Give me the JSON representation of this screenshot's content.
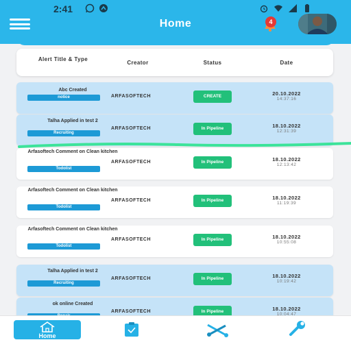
{
  "status_bar": {
    "time": "2:41"
  },
  "header": {
    "title": "Home",
    "notification_count": "4"
  },
  "table": {
    "columns": [
      "Alert Title & Type",
      "Creator",
      "Status",
      "Date"
    ]
  },
  "rows": [
    {
      "title": "Abc Created",
      "type": "notice",
      "creator": "ARFASOFTECH",
      "status": "CREATE",
      "date": "20.10.2022",
      "time": "14:37:16",
      "style": "blue"
    },
    {
      "title": "Talha Applied in test 2",
      "type": "Recruiting",
      "creator": "ARFASOFTECH",
      "status": "In Pipeline",
      "date": "18.10.2022",
      "time": "12:31:39",
      "style": "blue"
    },
    {
      "title": "Arfasoftech Comment on Clean kitchen",
      "type": "Todolist",
      "creator": "ARFASOFTECH",
      "status": "In Pipeline",
      "date": "18.10.2022",
      "time": "12:13:42",
      "style": "white"
    },
    {
      "title": "Arfasoftech Comment on Clean kitchen",
      "type": "Todolist",
      "creator": "ARFASOFTECH",
      "status": "In Pipeline",
      "date": "18.10.2022",
      "time": "11:19:39",
      "style": "white"
    },
    {
      "title": "Arfasoftech Comment on Clean kitchen",
      "type": "Todolist",
      "creator": "ARFASOFTECH",
      "status": "In Pipeline",
      "date": "18.10.2022",
      "time": "10:55:08",
      "style": "white"
    },
    {
      "title": "Talha Applied in test 2",
      "type": "Recruiting",
      "creator": "ARFASOFTECH",
      "status": "In Pipeline",
      "date": "18.10.2022",
      "time": "10:19:42",
      "style": "blue"
    },
    {
      "title": "ok online Created",
      "type": "Repair",
      "creator": "ARFASOFTECH",
      "status": "In Pipeline",
      "date": "18.10.2022",
      "time": "10:04:47",
      "style": "blue"
    }
  ],
  "bottom_nav": {
    "home_label": "Home"
  },
  "colors": {
    "primary": "#2bb6ea",
    "status_green": "#22c07a",
    "tag_blue": "#1d9ad6",
    "row_blue": "#c5e3f8",
    "notification_red": "#e53935",
    "highlight_line": "#3ce39a"
  }
}
